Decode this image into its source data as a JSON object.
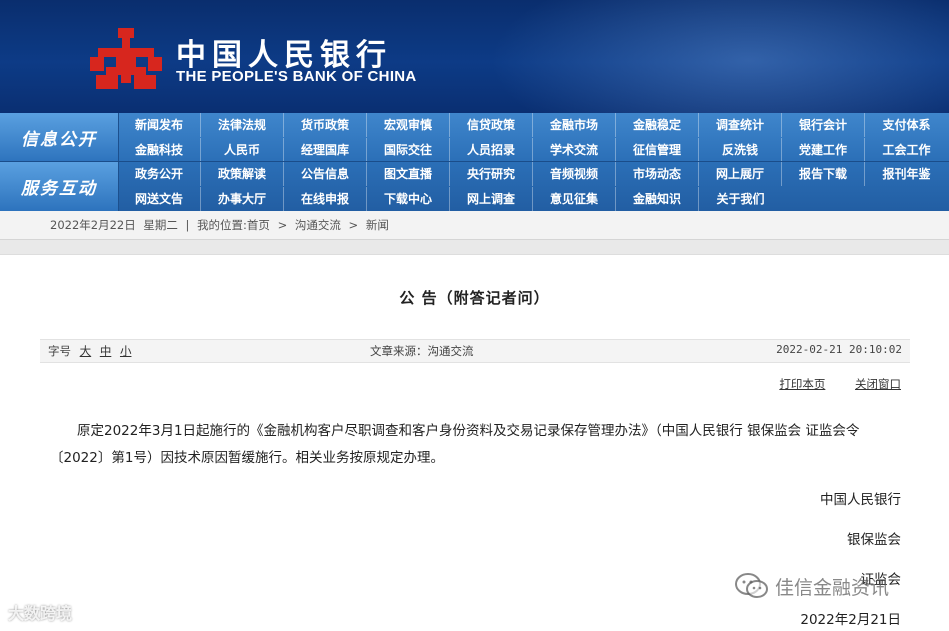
{
  "header": {
    "title_cn": "中国人民银行",
    "title_en": "THE PEOPLE'S BANK OF CHINA",
    "logo_color": "#d7261e"
  },
  "nav": {
    "info": {
      "label": "信息公开",
      "row1": [
        "新闻发布",
        "法律法规",
        "货币政策",
        "宏观审慎",
        "信贷政策",
        "金融市场",
        "金融稳定",
        "调查统计",
        "银行会计",
        "支付体系"
      ],
      "row2": [
        "金融科技",
        "人民币",
        "经理国库",
        "国际交往",
        "人员招录",
        "学术交流",
        "征信管理",
        "反洗钱",
        "党建工作",
        "工会工作"
      ]
    },
    "service": {
      "label": "服务互动",
      "row1": [
        "政务公开",
        "政策解读",
        "公告信息",
        "图文直播",
        "央行研究",
        "音频视频",
        "市场动态",
        "网上展厅",
        "报告下载",
        "报刊年鉴"
      ],
      "row2": [
        "网送文告",
        "办事大厅",
        "在线申报",
        "下载中心",
        "网上调查",
        "意见征集",
        "金融知识",
        "关于我们"
      ]
    }
  },
  "breadcrumb": {
    "date": "2022年2月22日",
    "weekday": "星期二",
    "sep": "|",
    "location_label": "我的位置:首页",
    "crumb_sep": ">",
    "crumb2": "沟通交流",
    "crumb3": "新闻"
  },
  "article": {
    "title": "公 告（附答记者问）",
    "font_size_label": "字号",
    "font_big": "大",
    "font_mid": "中",
    "font_small": "小",
    "source": "文章来源：沟通交流",
    "datetime": "2022-02-21 20:10:02",
    "print": "打印本页",
    "close": "关闭窗口",
    "body": "原定2022年3月1日起施行的《金融机构客户尽职调查和客户身份资料及交易记录保存管理办法》（中国人民银行 银保监会 证监会令〔2022〕第1号）因技术原因暂缓施行。相关业务按原规定办理。",
    "sign1": "中国人民银行",
    "sign2": "银保监会",
    "sign3": "证监会",
    "sign_date": "2022年2月21日"
  },
  "watermarks": {
    "left": "大数跨境",
    "right": "佳信金融资讯"
  }
}
